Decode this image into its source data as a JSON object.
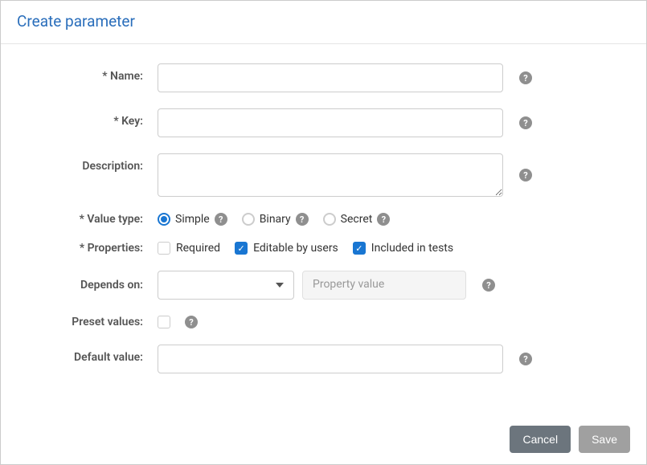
{
  "dialog": {
    "title": "Create parameter"
  },
  "labels": {
    "name": "* Name:",
    "key": "* Key:",
    "description": "Description:",
    "value_type": "* Value type:",
    "properties": "* Properties:",
    "depends_on": "Depends on:",
    "preset_values": "Preset values:",
    "default_value": "Default value:"
  },
  "fields": {
    "name_value": "",
    "key_value": "",
    "description_value": "",
    "default_value": ""
  },
  "value_type": {
    "options": {
      "simple": "Simple",
      "binary": "Binary",
      "secret": "Secret"
    },
    "selected": "simple"
  },
  "properties": {
    "required": {
      "label": "Required",
      "checked": false
    },
    "editable": {
      "label": "Editable by users",
      "checked": true
    },
    "included": {
      "label": "Included in tests",
      "checked": true
    }
  },
  "depends_on": {
    "selected": "",
    "property_value_placeholder": "Property value"
  },
  "preset_values": {
    "checked": false
  },
  "buttons": {
    "cancel": "Cancel",
    "save": "Save"
  },
  "icons": {
    "help_glyph": "?"
  }
}
